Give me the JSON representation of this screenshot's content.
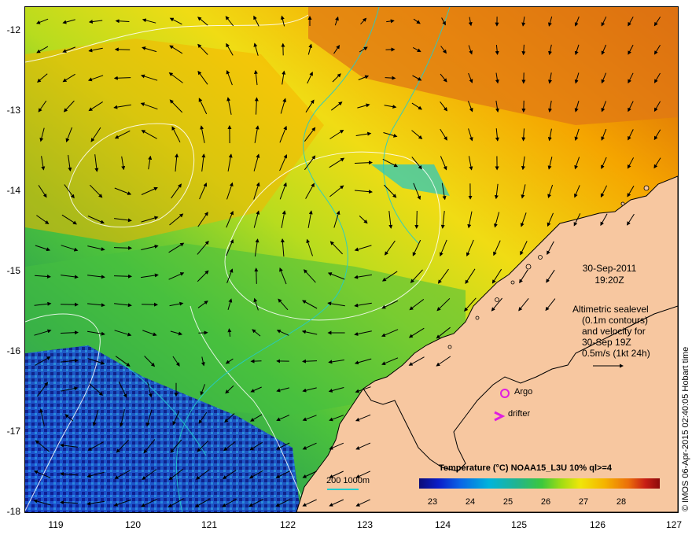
{
  "map": {
    "lat_labels": [
      "-12",
      "-13",
      "-14",
      "-15",
      "-16",
      "-17",
      "-18"
    ],
    "lon_labels": [
      "119",
      "120",
      "121",
      "122",
      "123",
      "124",
      "125",
      "126",
      "127"
    ],
    "lat_range": [
      -18,
      -11.7
    ],
    "lon_range": [
      118.6,
      127
    ]
  },
  "timestamp": {
    "date": "30-Sep-2011",
    "time": "19:20Z"
  },
  "altimetry_note": {
    "line1": "Altimetric sealevel",
    "line2": "(0.1m contours)",
    "line3": "and velocity for",
    "line4": "30-Sep 19Z",
    "line5": "0.5m/s (1kt 24h)"
  },
  "legend": {
    "argo": "Argo",
    "drifter": "drifter",
    "bathymetry": "200  1000m"
  },
  "colorbar": {
    "title": "Temperature (°C) NOAA15_L3U 10% ql>=4",
    "ticks": [
      "23",
      "24",
      "25",
      "26",
      "27",
      "28"
    ],
    "colors": {
      "cold": "#0b0b78",
      "mid": "#3cc83c",
      "warm": "#f0e60a",
      "hot": "#8c0a0a"
    }
  },
  "credit": "© IMOS 06-Apr-2015 02:40:05 Hobart time",
  "colors": {
    "land": "#f7c7a0",
    "coastline": "#000000",
    "contour": "#ffffff",
    "bathymetry": "#22cccc",
    "argo": "#e01ee0"
  }
}
